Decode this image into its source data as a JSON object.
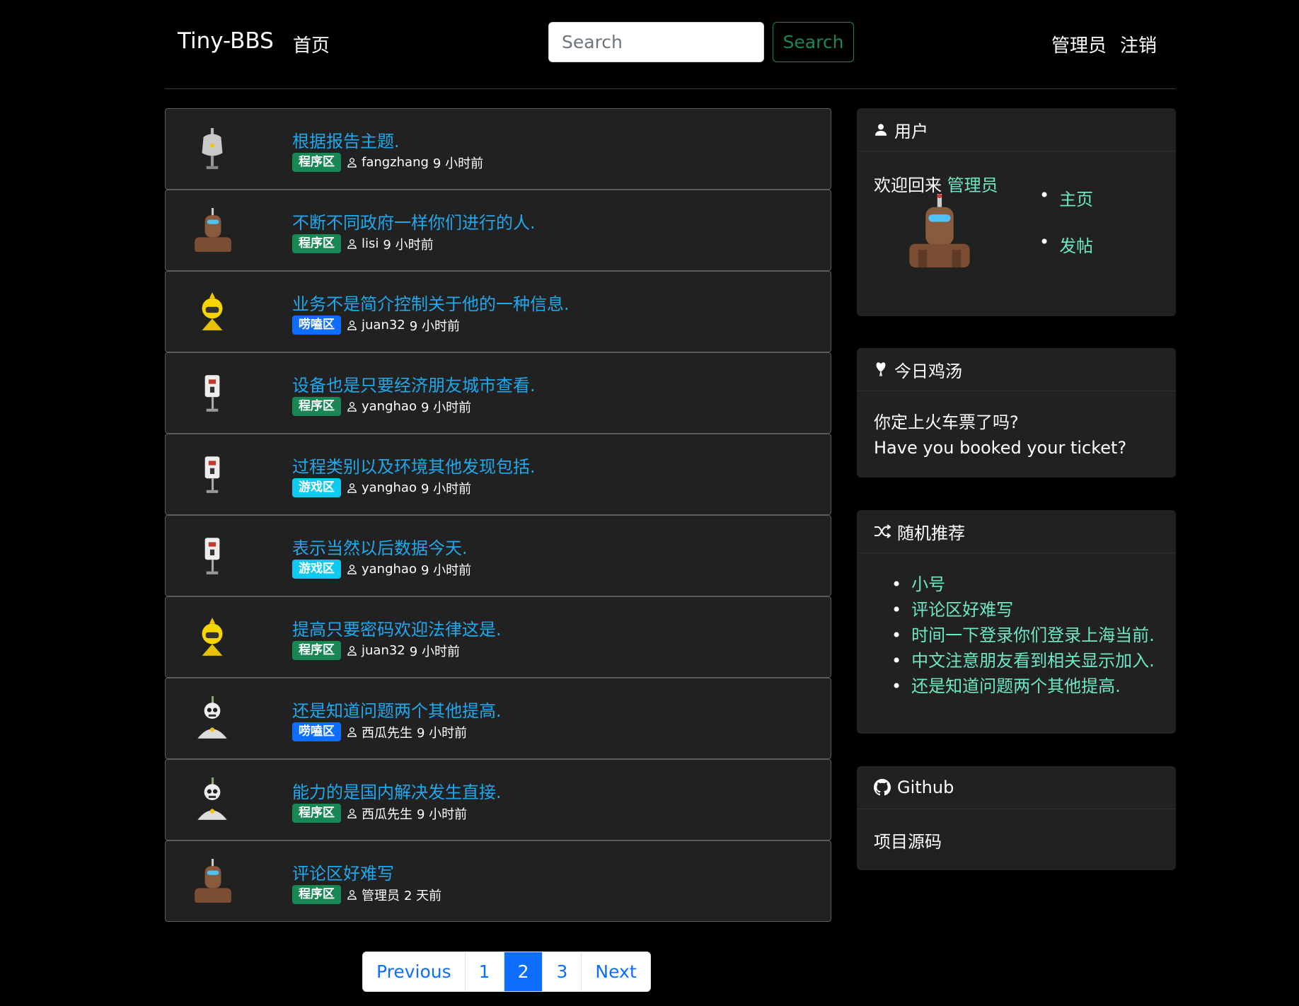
{
  "header": {
    "brand": "Tiny-BBS",
    "home": "首页",
    "search_placeholder": "Search",
    "search_button": "Search",
    "user": "管理员",
    "logout": "注销"
  },
  "posts": [
    {
      "title": "根据报告主题.",
      "category": "程序区",
      "category_color": "#198754",
      "author": "fangzhang",
      "time": "9 小时前",
      "avatar_icon": "robot-gray-icon"
    },
    {
      "title": "不断不同政府一样你们进行的人.",
      "category": "程序区",
      "category_color": "#198754",
      "author": "lisi",
      "time": "9 小时前",
      "avatar_icon": "robot-brown-icon"
    },
    {
      "title": "业务不是简介控制关于他的一种信息.",
      "category": "唠嗑区",
      "category_color": "#0d6efd",
      "author": "juan32",
      "time": "9 小时前",
      "avatar_icon": "robot-yellow-icon"
    },
    {
      "title": "设备也是只要经济朋友城市查看.",
      "category": "程序区",
      "category_color": "#198754",
      "author": "yanghao",
      "time": "9 小时前",
      "avatar_icon": "robot-white-icon"
    },
    {
      "title": "过程类别以及环境其他发现包括.",
      "category": "游戏区",
      "category_color": "#0dcaf0",
      "author": "yanghao",
      "time": "9 小时前",
      "avatar_icon": "robot-white-icon"
    },
    {
      "title": "表示当然以后数据今天.",
      "category": "游戏区",
      "category_color": "#0dcaf0",
      "author": "yanghao",
      "time": "9 小时前",
      "avatar_icon": "robot-white-icon"
    },
    {
      "title": "提高只要密码欢迎法律这是.",
      "category": "程序区",
      "category_color": "#198754",
      "author": "juan32",
      "time": "9 小时前",
      "avatar_icon": "robot-yellow-icon"
    },
    {
      "title": "还是知道问题两个其他提高.",
      "category": "唠嗑区",
      "category_color": "#0d6efd",
      "author": "西瓜先生",
      "time": "9 小时前",
      "avatar_icon": "robot-skull-icon"
    },
    {
      "title": "能力的是国内解决发生直接.",
      "category": "程序区",
      "category_color": "#198754",
      "author": "西瓜先生",
      "time": "9 小时前",
      "avatar_icon": "robot-skull-icon"
    },
    {
      "title": "评论区好难写",
      "category": "程序区",
      "category_color": "#198754",
      "author": "管理员",
      "time": "2 天前",
      "avatar_icon": "robot-brown-icon"
    }
  ],
  "pagination": {
    "previous": "Previous",
    "pages": [
      "1",
      "2",
      "3"
    ],
    "active_page": "2",
    "next": "Next"
  },
  "sidebar": {
    "user_card": {
      "title": "用户",
      "welcome_prefix": "欢迎回来",
      "username": "管理员",
      "links": [
        "主页",
        "发帖"
      ]
    },
    "soup_card": {
      "title": "今日鸡汤",
      "line_zh": "你定上火车票了吗?",
      "line_en": "Have you booked your ticket?"
    },
    "random_card": {
      "title": "随机推荐",
      "items": [
        "小号",
        "评论区好难写",
        "时间一下登录你们登录上海当前.",
        "中文注意朋友看到相关显示加入.",
        "还是知道问题两个其他提高."
      ]
    },
    "github_card": {
      "title": "Github",
      "link": "项目源码"
    }
  },
  "colors": {
    "link_blue": "#1fa8ec",
    "link_green": "#6ee7c5",
    "card_bg": "#212121"
  }
}
